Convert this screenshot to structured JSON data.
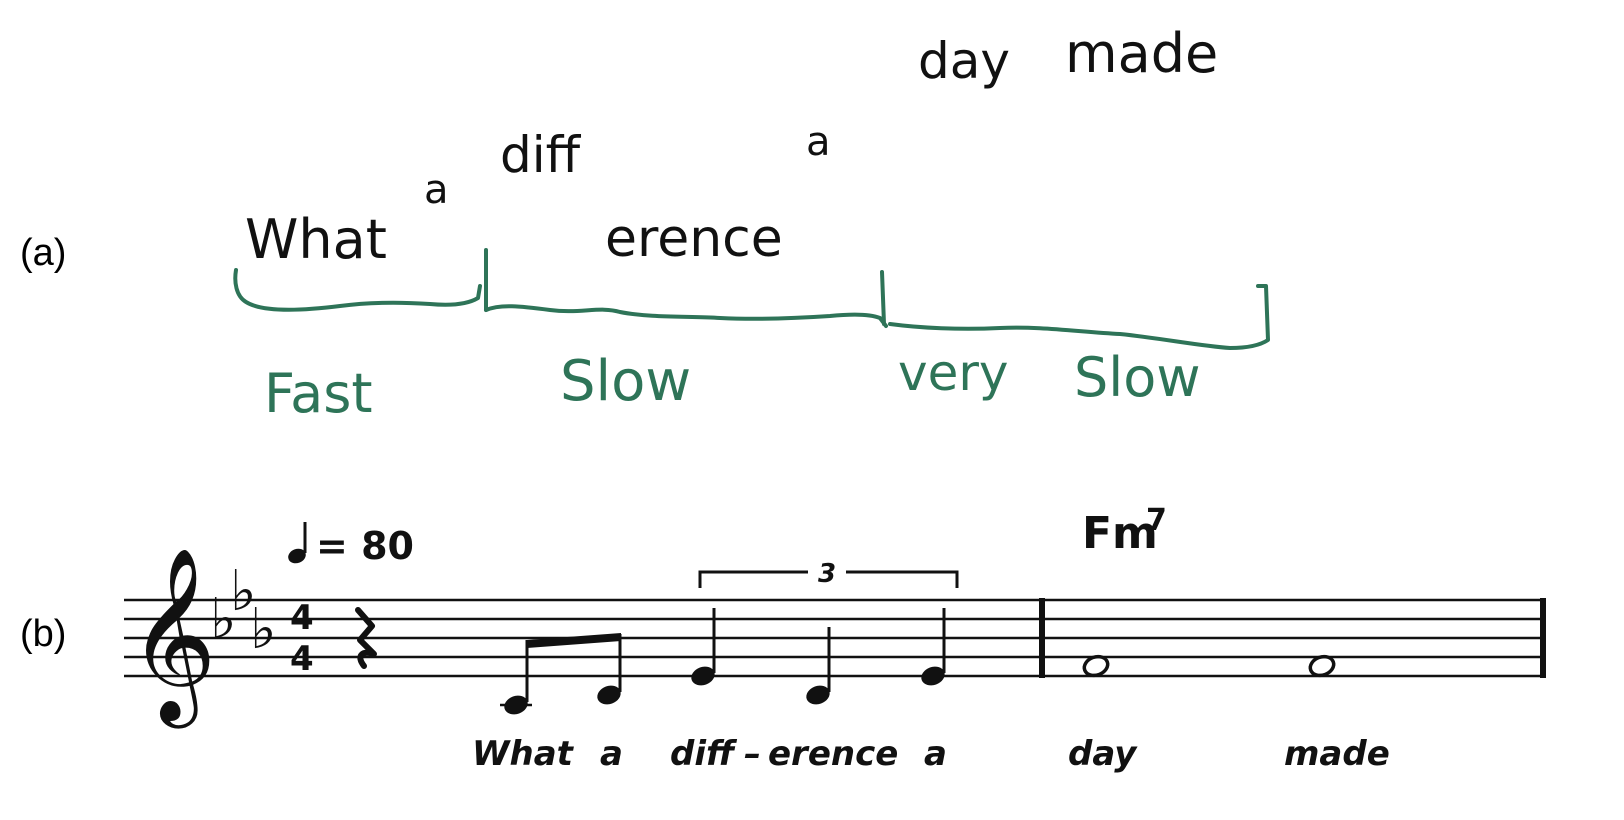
{
  "labels": {
    "a": "(a)",
    "b": "(b)"
  },
  "colors": {
    "ink": "#111111",
    "green": "#2e7458"
  },
  "panel_a": {
    "lyrics": {
      "what": "What",
      "a1": "a",
      "diff": "diff",
      "erence": "erence",
      "a2": "a",
      "day": "day",
      "made": "made"
    },
    "phrasing": {
      "fast": "Fast",
      "slow": "Slow",
      "very": "very",
      "slow2": "Slow"
    }
  },
  "panel_b": {
    "tempo": {
      "symbol": "quarter-note",
      "value": "= 80"
    },
    "time_signature": {
      "top": "4",
      "bottom": "4"
    },
    "key_signature": "3 flats",
    "chord": {
      "root": "Fm",
      "ext": "7"
    },
    "triplet_label": "3",
    "lyrics": [
      "What",
      "a",
      "diff",
      "–",
      "erence",
      "a",
      "day",
      "made"
    ]
  }
}
